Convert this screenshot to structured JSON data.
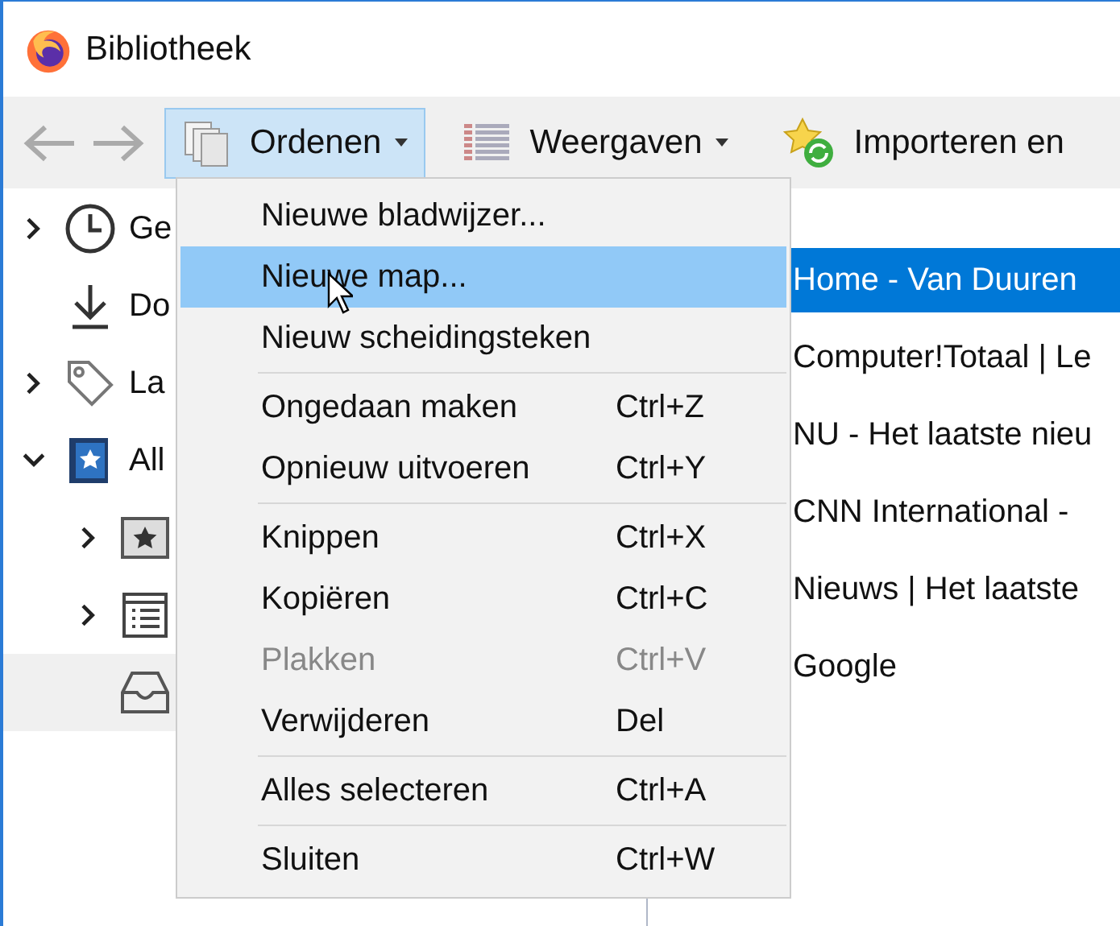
{
  "window": {
    "title": "Bibliotheek"
  },
  "toolbar": {
    "back": {
      "disabled": true
    },
    "forward": {
      "disabled": true
    },
    "buttons": [
      {
        "kind": "organize",
        "label": "Ordenen",
        "pressed": true,
        "dropdown": true
      },
      {
        "kind": "views",
        "label": "Weergaven",
        "pressed": false,
        "dropdown": true
      },
      {
        "kind": "import",
        "label": "Importeren en",
        "pressed": false,
        "dropdown": false
      }
    ]
  },
  "tree": [
    {
      "kind": "history",
      "label": "Ge",
      "expanded": false,
      "selected": false
    },
    {
      "kind": "downloads",
      "label": "Do",
      "selected": false
    },
    {
      "kind": "tags",
      "label": "La",
      "expanded": false,
      "selected": false
    },
    {
      "kind": "library",
      "label": "All",
      "expanded": true,
      "selected": false,
      "children": [
        {
          "kind": "star",
          "expanded": false,
          "selected": false
        },
        {
          "kind": "list",
          "expanded": false,
          "selected": false
        },
        {
          "kind": "tray",
          "selected": true
        }
      ]
    }
  ],
  "list": [
    {
      "title": "Home - Van Duuren",
      "selected": true
    },
    {
      "title": "Computer!Totaal | Le",
      "selected": false
    },
    {
      "title": "NU - Het laatste nieu",
      "selected": false
    },
    {
      "title": "CNN International -",
      "selected": false
    },
    {
      "title": "Nieuws | Het laatste",
      "selected": false
    },
    {
      "title": "Google",
      "selected": false
    }
  ],
  "menu": [
    {
      "kind": "item",
      "label": "Nieuwe bladwijzer...",
      "selected": false,
      "disabled": false
    },
    {
      "kind": "item",
      "label": "Nieuwe map...",
      "selected": true,
      "disabled": false
    },
    {
      "kind": "item",
      "label": "Nieuw scheidingsteken",
      "selected": false,
      "disabled": false
    },
    {
      "kind": "separator"
    },
    {
      "kind": "item",
      "label": "Ongedaan maken",
      "shortcut": "Ctrl+Z",
      "selected": false,
      "disabled": false
    },
    {
      "kind": "item",
      "label": "Opnieuw uitvoeren",
      "shortcut": "Ctrl+Y",
      "selected": false,
      "disabled": false
    },
    {
      "kind": "separator"
    },
    {
      "kind": "item",
      "label": "Knippen",
      "shortcut": "Ctrl+X",
      "selected": false,
      "disabled": false
    },
    {
      "kind": "item",
      "label": "Kopiëren",
      "shortcut": "Ctrl+C",
      "selected": false,
      "disabled": false
    },
    {
      "kind": "item",
      "label": "Plakken",
      "shortcut": "Ctrl+V",
      "selected": false,
      "disabled": true
    },
    {
      "kind": "item",
      "label": "Verwijderen",
      "shortcut": "Del",
      "selected": false,
      "disabled": false
    },
    {
      "kind": "separator"
    },
    {
      "kind": "item",
      "label": "Alles selecteren",
      "shortcut": "Ctrl+A",
      "selected": false,
      "disabled": false
    },
    {
      "kind": "separator"
    },
    {
      "kind": "item",
      "label": "Sluiten",
      "shortcut": "Ctrl+W",
      "selected": false,
      "disabled": false
    }
  ]
}
